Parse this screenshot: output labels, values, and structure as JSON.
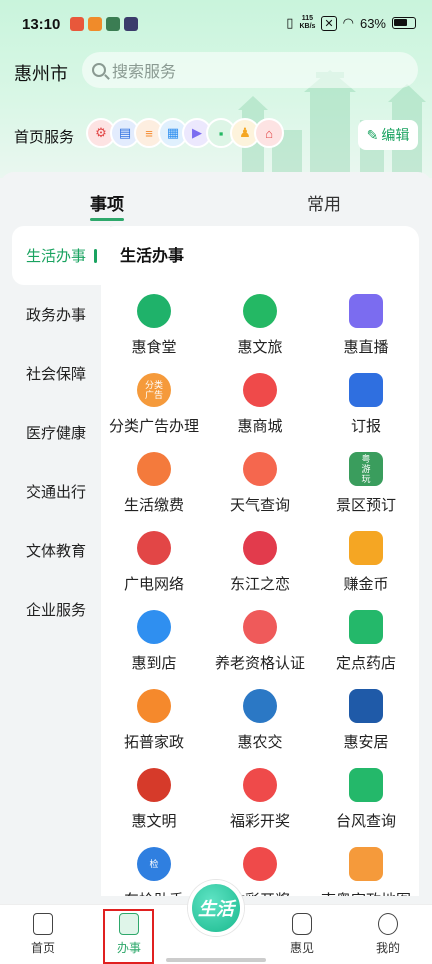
{
  "status_bar": {
    "time": "13:10",
    "net_speed": "115\nKB/s",
    "battery": "63%"
  },
  "header": {
    "city": "惠州市",
    "search_placeholder": "搜索服务",
    "services_label": "首页服务",
    "edit_label": "编辑"
  },
  "tabs": [
    {
      "label": "事项",
      "active": true
    },
    {
      "label": "常用",
      "active": false
    }
  ],
  "left_nav": [
    {
      "label": "生活办事",
      "active": true
    },
    {
      "label": "政务办事"
    },
    {
      "label": "社会保障"
    },
    {
      "label": "医疗健康"
    },
    {
      "label": "交通出行"
    },
    {
      "label": "文体教育"
    },
    {
      "label": "企业服务"
    }
  ],
  "section_title": "生活办事",
  "services": [
    {
      "label": "惠食堂",
      "icon": "dining-bell-icon",
      "color": "#1fb26a"
    },
    {
      "label": "惠文旅",
      "icon": "chat-bubble-icon",
      "color": "#24b864"
    },
    {
      "label": "惠直播",
      "icon": "live-play-icon",
      "color": "#7b6cf0"
    },
    {
      "label": "分类广告办理",
      "icon": "classified-ads-icon",
      "color": "#f59a3b",
      "icon_text": "分类\n广告"
    },
    {
      "label": "惠商城",
      "icon": "shopping-cart-icon",
      "color": "#ef4a4a"
    },
    {
      "label": "订报",
      "icon": "newspaper-icon",
      "color": "#2f6fe0"
    },
    {
      "label": "生活缴费",
      "icon": "wallet-icon",
      "color": "#f47a3c"
    },
    {
      "label": "天气查询",
      "icon": "weather-icon",
      "color": "#f5674e"
    },
    {
      "label": "景区预订",
      "icon": "scenic-booking-icon",
      "color": "#3a9d5d",
      "icon_text": "粤\n游\n玩"
    },
    {
      "label": "广电网络",
      "icon": "broadcast-icon",
      "color": "#e24646"
    },
    {
      "label": "东江之恋",
      "icon": "heart-logo-icon",
      "color": "#e23b4c"
    },
    {
      "label": "赚金币",
      "icon": "coin-icon",
      "color": "#f5a623"
    },
    {
      "label": "惠到店",
      "icon": "store-building-icon",
      "color": "#2f8ff0"
    },
    {
      "label": "养老资格认证",
      "icon": "elderly-care-icon",
      "color": "#ef5a5a"
    },
    {
      "label": "定点药店",
      "icon": "pharmacy-icon",
      "color": "#24b86a"
    },
    {
      "label": "拓普家政",
      "icon": "housekeeping-icon",
      "color": "#f5892c"
    },
    {
      "label": "惠农交",
      "icon": "agri-trade-icon",
      "color": "#2b78c5"
    },
    {
      "label": "惠安居",
      "icon": "house-icon",
      "color": "#1f5aa8"
    },
    {
      "label": "惠文明",
      "icon": "civilization-badge-icon",
      "color": "#d63a2a"
    },
    {
      "label": "福彩开奖",
      "icon": "welfare-lottery-icon",
      "color": "#ef4a4a"
    },
    {
      "label": "台风查询",
      "icon": "typhoon-icon",
      "color": "#24b86a"
    },
    {
      "label": "车检助手",
      "icon": "car-inspection-icon",
      "color": "#2f7fe0",
      "icon_text": "检"
    },
    {
      "label": "体彩开奖",
      "icon": "sports-lottery-icon",
      "color": "#ef4a4a"
    },
    {
      "label": "南粤家政地图",
      "icon": "map-pin-icon",
      "color": "#f59a3b"
    }
  ],
  "bottom_nav": [
    {
      "label": "首页",
      "icon": "home-doc-icon"
    },
    {
      "label": "办事",
      "icon": "bookmark-icon",
      "active": true
    },
    {
      "label": "生活",
      "icon": "life-center-icon"
    },
    {
      "label": "惠见",
      "icon": "message-icon"
    },
    {
      "label": "我的",
      "icon": "smile-face-icon"
    }
  ]
}
